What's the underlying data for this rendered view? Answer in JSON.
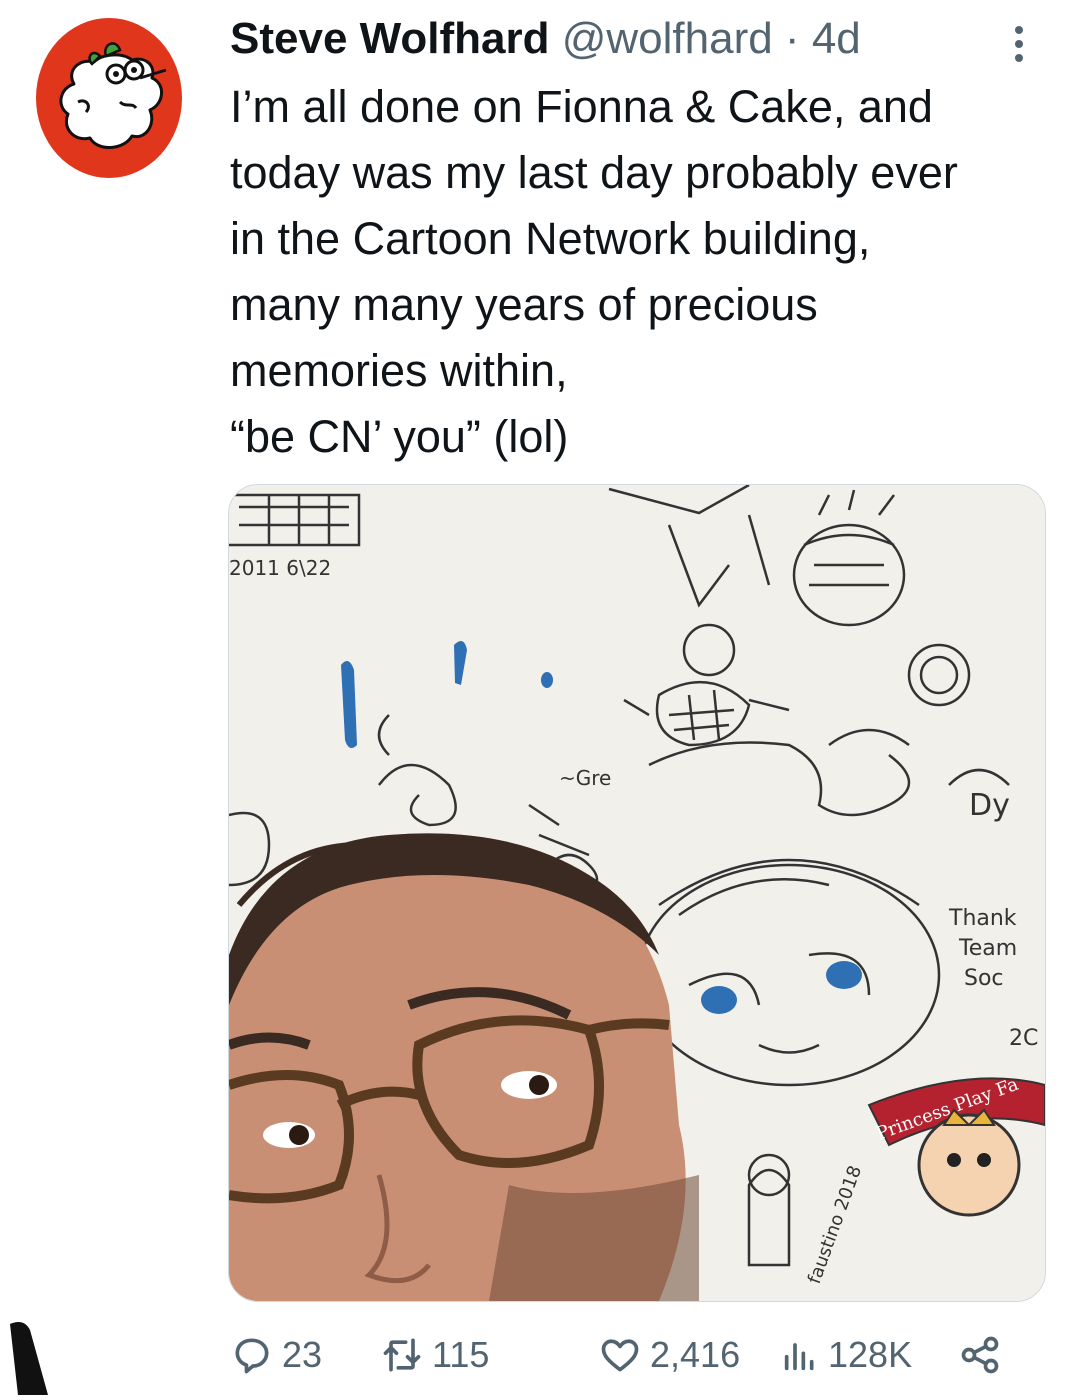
{
  "tweet": {
    "display_name": "Steve Wolfhard",
    "handle": "@wolfhard",
    "separator": " · ",
    "time": "4d",
    "text_lines": [
      "I’m all done on Fionna & Cake, and",
      "today was my last day probably ever",
      "in the Cartoon Network building,",
      "many many years of precious",
      "memories within,",
      "“be CN’ you” (lol)"
    ]
  },
  "actions": {
    "replies": "23",
    "reposts": "115",
    "likes": "2,416",
    "views": "128K"
  },
  "icons": {
    "more": "more-vertical-icon",
    "reply": "reply-icon",
    "repost": "repost-icon",
    "like": "heart-icon",
    "views": "views-icon",
    "share": "share-icon"
  },
  "media": {
    "doodle_text": {
      "date": "2011 6\\22",
      "thank": "Thank",
      "team": "Team",
      "soc": "Soc",
      "twenty": "2C",
      "dy": "Dy",
      "banner": "Princess Play Fa",
      "signature": "faustino 2018",
      "gre": "~Gre"
    }
  },
  "colors": {
    "avatar_bg": "#e0361c",
    "text_primary": "#0f1419",
    "text_secondary": "#536471",
    "banner_red": "#b3222e"
  }
}
